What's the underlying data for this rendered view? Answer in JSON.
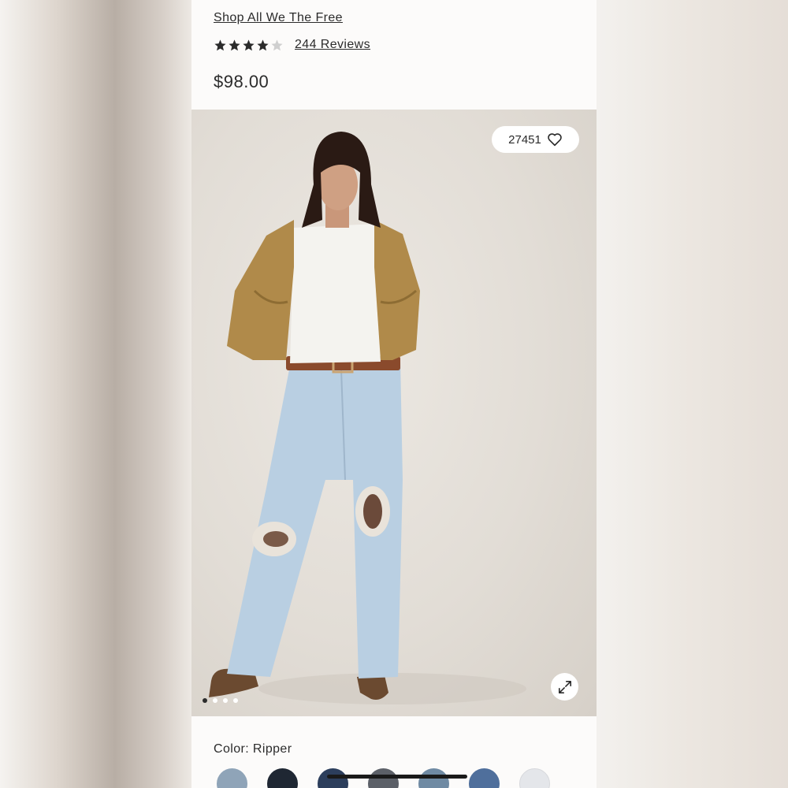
{
  "header": {
    "brand_link": "Shop All We The Free",
    "rating": 4,
    "rating_max": 5,
    "reviews_link": "244 Reviews",
    "price": "$98.00"
  },
  "gallery": {
    "favorites_count": "27451",
    "image_count": 4,
    "active_image": 1
  },
  "color": {
    "label": "Color: Ripper",
    "swatches": [
      "#8fa4b8",
      "#1f2733",
      "#2c3e5c",
      "#5c6068",
      "#6f8aa3",
      "#4f6f9c",
      "#e4e6ea"
    ]
  },
  "icons": {
    "star": "star-icon",
    "heart": "heart-icon",
    "expand": "expand-icon"
  }
}
